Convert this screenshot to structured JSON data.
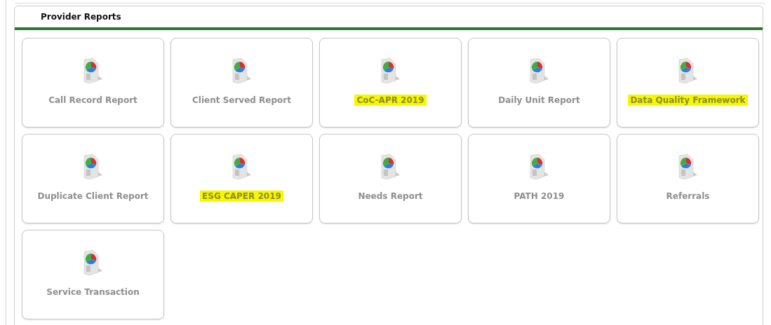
{
  "panel": {
    "title": "Provider Reports"
  },
  "reports": [
    {
      "label": "Call Record Report",
      "highlighted": false
    },
    {
      "label": "Client Served Report",
      "highlighted": false
    },
    {
      "label": "CoC-APR 2019",
      "highlighted": true
    },
    {
      "label": "Daily Unit Report",
      "highlighted": false
    },
    {
      "label": "Data Quality Framework",
      "highlighted": true
    },
    {
      "label": "Duplicate Client Report",
      "highlighted": false
    },
    {
      "label": "ESG CAPER 2019",
      "highlighted": true
    },
    {
      "label": "Needs Report",
      "highlighted": false
    },
    {
      "label": "PATH 2019",
      "highlighted": false
    },
    {
      "label": "Referrals",
      "highlighted": false
    },
    {
      "label": "Service Transaction",
      "highlighted": false
    }
  ]
}
